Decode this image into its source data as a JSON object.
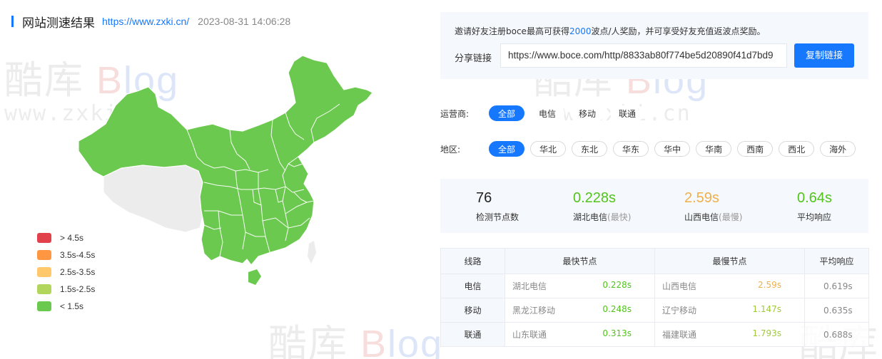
{
  "header": {
    "title": "网站测速结果",
    "url": "https://www.zxki.cn/",
    "timestamp": "2023-08-31 14:06:28"
  },
  "watermark": {
    "brand_cn": "酷库",
    "brand_b": "B",
    "brand_rest": "log",
    "url": "www.zxki.cn"
  },
  "map": {
    "color_fast": "#6cc94f",
    "color_nodata": "#ececec"
  },
  "legend": [
    {
      "label": "> 4.5s",
      "color": "#e0414a"
    },
    {
      "label": "3.5s-4.5s",
      "color": "#ff9642"
    },
    {
      "label": "2.5s-3.5s",
      "color": "#ffc96b"
    },
    {
      "label": "1.5s-2.5s",
      "color": "#b1d65b"
    },
    {
      "label": "< 1.5s",
      "color": "#6cc94f"
    }
  ],
  "share": {
    "invite_pre": "邀请好友注册boce最高可获得",
    "invite_num": "2000",
    "invite_post": "波点/人奖励，并可享受好友充值返波点奖励。",
    "label": "分享链接",
    "link": "https://www.boce.com/http/8833ab80f774be5d20890f41d7bd9",
    "copy_label": "复制链接"
  },
  "filters": {
    "isp_label": "运营商:",
    "isp": [
      "全部",
      "电信",
      "移动",
      "联通"
    ],
    "region_label": "地区:",
    "regions": [
      "全部",
      "华北",
      "东北",
      "华东",
      "华中",
      "华南",
      "西南",
      "西北",
      "海外"
    ]
  },
  "stats": {
    "nodes_value": "76",
    "nodes_label": "检测节点数",
    "fastest_value": "0.228s",
    "fastest_label": "湖北电信",
    "fastest_note": "(最快)",
    "slowest_value": "2.59s",
    "slowest_label": "山西电信",
    "slowest_note": "(最慢)",
    "avg_value": "0.64s",
    "avg_label": "平均响应"
  },
  "table": {
    "headers": [
      "线路",
      "最快节点",
      "最慢节点",
      "平均响应"
    ],
    "rows": [
      {
        "line": "电信",
        "fast_node": "湖北电信",
        "fast_time": "0.228s",
        "slow_node": "山西电信",
        "slow_time": "2.59s",
        "avg": "0.619s"
      },
      {
        "line": "移动",
        "fast_node": "黑龙江移动",
        "fast_time": "0.248s",
        "slow_node": "辽宁移动",
        "slow_time": "1.147s",
        "avg": "0.635s"
      },
      {
        "line": "联通",
        "fast_node": "山东联通",
        "fast_time": "0.313s",
        "slow_node": "福建联通",
        "slow_time": "1.793s",
        "avg": "0.688s"
      }
    ]
  }
}
